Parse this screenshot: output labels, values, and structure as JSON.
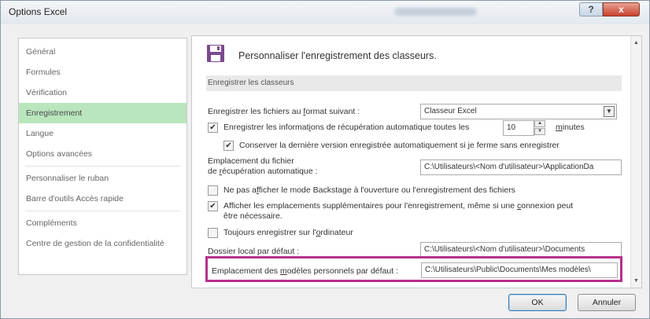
{
  "window": {
    "title": "Options Excel",
    "help_glyph": "?",
    "close_glyph": "x"
  },
  "sidebar": {
    "items": [
      {
        "label": "Général"
      },
      {
        "label": "Formules"
      },
      {
        "label": "Vérification"
      },
      {
        "label": "Enregistrement",
        "selected": true
      },
      {
        "label": "Langue"
      },
      {
        "label": "Options avancées"
      },
      {
        "label": "Personnaliser le ruban"
      },
      {
        "label": "Barre d'outils Accès rapide"
      },
      {
        "label": "Compléments"
      },
      {
        "label": "Centre de gestion de la confidentialité"
      }
    ]
  },
  "main": {
    "title": "Personnaliser l'enregistrement des classeurs.",
    "section_header": "Enregistrer les classeurs",
    "format": {
      "label_pre": "Enregistrer les fichiers au ",
      "label_ul": "f",
      "label_post": "ormat suivant :",
      "value": "Classeur Excel"
    },
    "autorecover": {
      "checked": true,
      "label_pre": "Enregistrer les informat",
      "label_ul": "i",
      "label_post": "ons de récupération automatique toutes les",
      "minutes_value": "10",
      "unit_ul": "m",
      "unit_post": "inutes"
    },
    "keep_last": {
      "checked": true,
      "label": "Conserver la dernière version enregistrée automatiquement si je ferme sans enregistrer"
    },
    "autorecover_location": {
      "label_line1": "Emplacement du fichier",
      "label_line2_pre": "de ",
      "label_line2_ul": "r",
      "label_line2_post": "écupération automatique :",
      "value": "C:\\Utilisateurs\\<Nom d'utilisateur>\\ApplicationDa"
    },
    "no_backstage": {
      "checked": false,
      "label_pre": "Ne pas a",
      "label_ul": "f",
      "label_post": "ficher le mode Backstage à l'ouverture ou l'enregistrement des fichiers"
    },
    "show_additional": {
      "checked": true,
      "label_line1_pre": "Afficher les emplacements supplémentaires pour l'enregistrement, même si une ",
      "label_line1_ul": "c",
      "label_line1_post": "onnexion peut",
      "label_line2": "être nécessaire."
    },
    "always_computer": {
      "checked": false,
      "label_pre": "Toujours enregistrer sur l'",
      "label_ul": "o",
      "label_post": "rdinateur"
    },
    "default_local": {
      "label": "Dossier local par défaut :",
      "value": "C:\\Utilisateurs\\<Nom d'utilisateur>\\Documents"
    },
    "personal_templates": {
      "label_pre": "Emplacement des ",
      "label_ul": "m",
      "label_post": "odèles personnels par défaut :",
      "value": "C:\\Utilisateurs\\Public\\Documents\\Mes modèles\\"
    },
    "check_glyph": "✔"
  },
  "footer": {
    "ok_label": "OK",
    "cancel_label": "Annuler"
  },
  "colors": {
    "selected_nav": "#b9e6bd",
    "highlight_box": "#b5308d",
    "close_button": "#c8422d"
  }
}
